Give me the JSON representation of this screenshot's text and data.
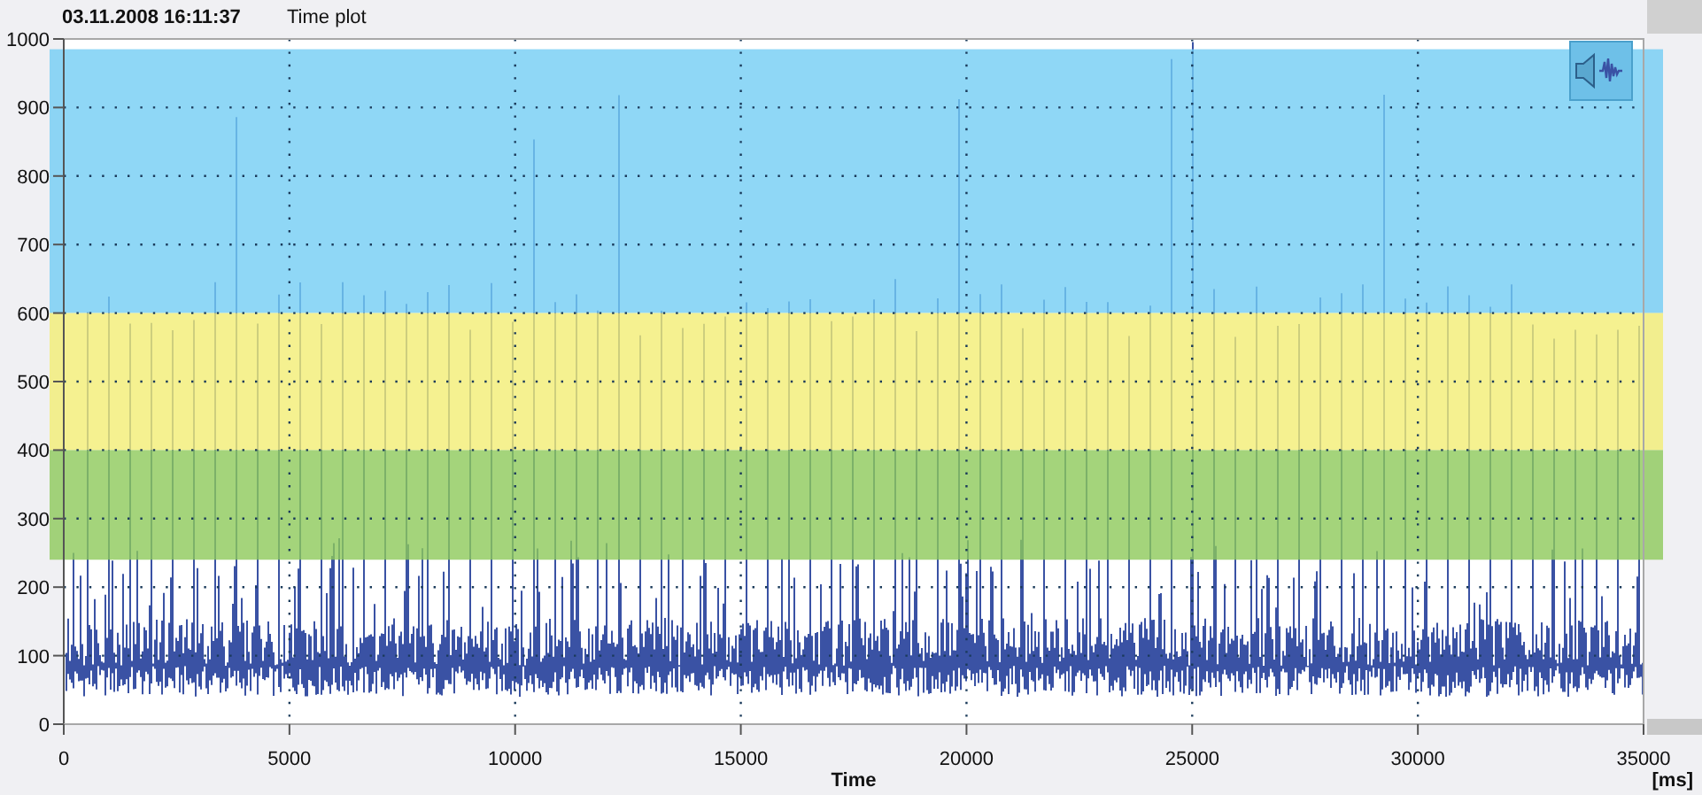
{
  "header": {
    "timestamp": "03.11.2008 16:11:37",
    "title": "Time plot"
  },
  "plot": {
    "x_unit": "[ms]",
    "chart_data": {
      "type": "line",
      "xlabel": "Time",
      "xlim": [
        0,
        35000
      ],
      "ylim": [
        0,
        1000
      ],
      "xticks": [
        0,
        5000,
        10000,
        15000,
        20000,
        25000,
        30000,
        35000
      ],
      "yticks": [
        0,
        100,
        200,
        300,
        400,
        500,
        600,
        700,
        800,
        900,
        1000
      ],
      "grid": true,
      "bands": [
        {
          "axis": "y",
          "from": 600,
          "to": 985,
          "color": "#73cdf4"
        },
        {
          "axis": "y",
          "from": 400,
          "to": 600,
          "color": "#f3ee74"
        },
        {
          "axis": "y",
          "from": 240,
          "to": 400,
          "color": "#8dc95a"
        }
      ]
    }
  }
}
